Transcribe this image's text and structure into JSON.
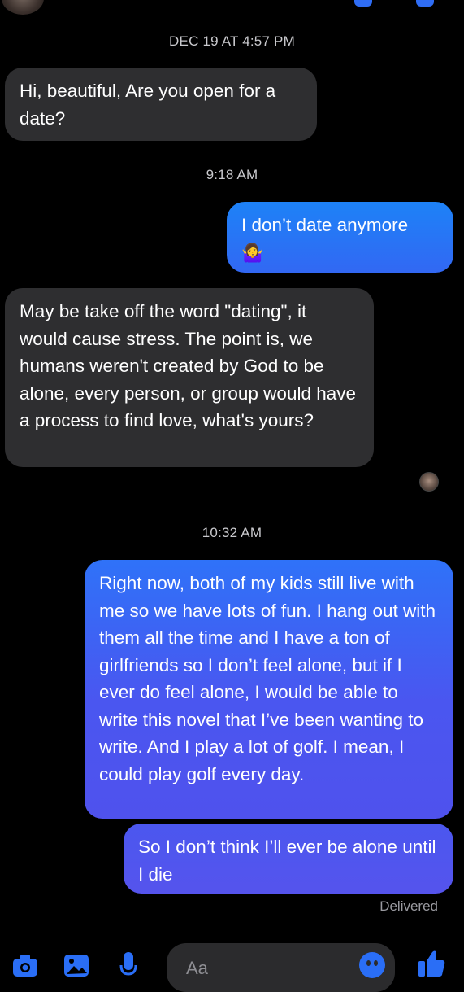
{
  "conversation": {
    "messages": [
      {
        "type": "timestamp",
        "text": "DEC 19 AT 4:57 PM"
      },
      {
        "type": "received",
        "text": "Hi, beautiful, Are you open for a date?"
      },
      {
        "type": "timestamp",
        "text": "9:18 AM"
      },
      {
        "type": "sent",
        "text": "I don’t date anymore",
        "emoji": "🤷‍♀️"
      },
      {
        "type": "received",
        "text": "May be take off the word \"dating\", it would cause stress. The point is, we humans weren't created by God to be alone, every person, or group would have a process to find love, what's yours?"
      },
      {
        "type": "timestamp",
        "text": "10:32 AM"
      },
      {
        "type": "sent",
        "text": "Right now, both of my kids still live with me so we have lots of fun. I hang out with them all the time and I have a ton of girlfriends so I don’t feel alone, but if I ever do feel alone, I would be able to write this novel that I’ve been wanting to write. And I play a lot of golf. I mean, I could play golf every day."
      },
      {
        "type": "sent",
        "text": "So I don’t think I’ll ever be alone until I die"
      }
    ],
    "delivered_status": "Delivered"
  },
  "composer": {
    "placeholder": "Aa",
    "icons": [
      "camera-icon",
      "photo-icon",
      "microphone-icon",
      "emoji-icon",
      "thumbs-up-icon"
    ]
  },
  "colors": {
    "background": "#000000",
    "received_bubble": "#2e2e30",
    "sent_bubble_top": "#1d82f7",
    "sent_bubble_bottom": "#5554ed",
    "accent": "#2a6ef6"
  }
}
